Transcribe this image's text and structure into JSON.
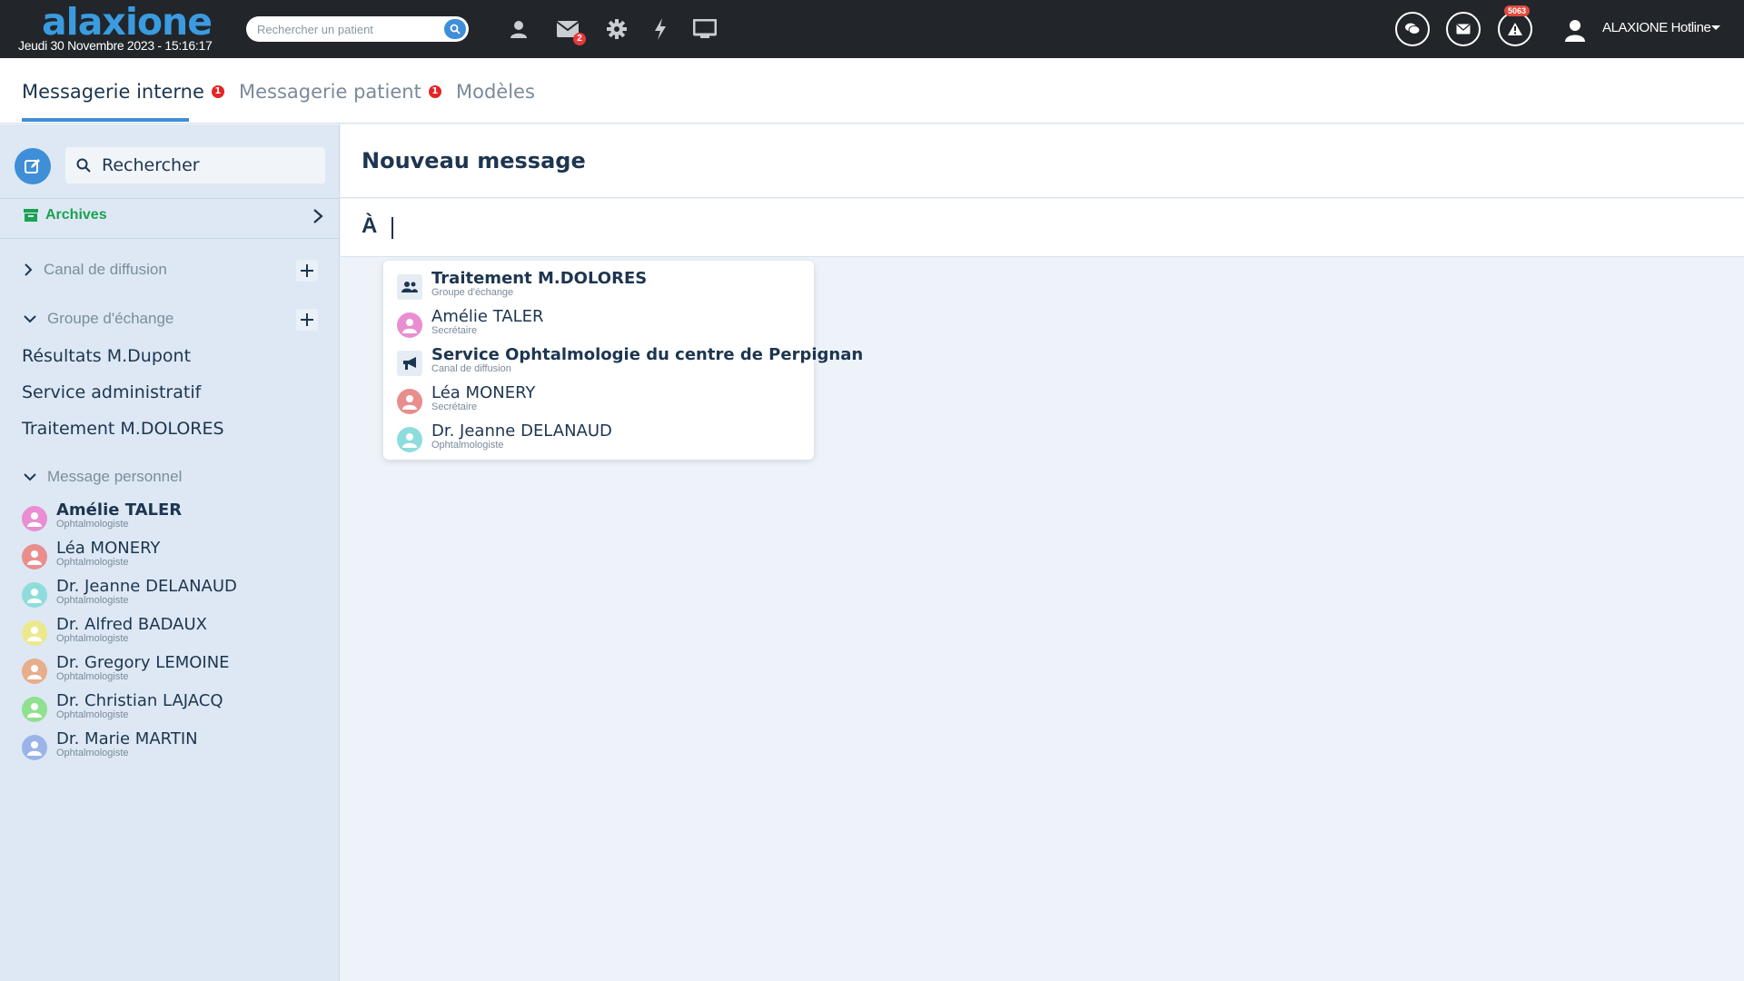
{
  "topbar": {
    "logo": "alaxione",
    "datetime": "Jeudi 30 Novembre 2023 - 15:16:17",
    "search_placeholder": "Rechercher un patient",
    "mail_badge": "2",
    "alert_badge": "5063",
    "user_name": "ALAXIONE Hotline"
  },
  "tabs": [
    {
      "label": "Messagerie interne",
      "badge": "1"
    },
    {
      "label": "Messagerie patient",
      "badge": "1"
    },
    {
      "label": "Modèles"
    }
  ],
  "sidebar": {
    "search_placeholder": "Rechercher",
    "archives_label": "Archives",
    "sections": {
      "broadcast": "Canal de diffusion",
      "exchange_group": "Groupe d'échange",
      "personal": "Message personnel"
    },
    "groups": [
      "Résultats M.Dupont",
      "Service administratif",
      "Traitement M.DOLORES"
    ],
    "contacts": [
      {
        "name": "Amélie TALER",
        "role": "Ophtalmologiste",
        "color": "#e98ed2",
        "bold": true
      },
      {
        "name": "Léa MONERY",
        "role": "Ophtalmologiste",
        "color": "#e98d8d"
      },
      {
        "name": "Dr. Jeanne DELANAUD",
        "role": "Ophtalmologiste",
        "color": "#8fdcdc"
      },
      {
        "name": "Dr. Alfred BADAUX",
        "role": "Ophtalmologiste",
        "color": "#ece98d"
      },
      {
        "name": "Dr. Gregory LEMOINE",
        "role": "Ophtalmologiste",
        "color": "#e8ad8a"
      },
      {
        "name": "Dr. Christian LAJACQ",
        "role": "Ophtalmologiste",
        "color": "#8fe08f"
      },
      {
        "name": "Dr. Marie MARTIN",
        "role": "Ophtalmologiste",
        "color": "#9ab4ea"
      }
    ]
  },
  "main": {
    "title": "Nouveau message",
    "to_label": "À",
    "suggestions": [
      {
        "name": "Traitement M.DOLORES",
        "sub": "Groupe d'échange",
        "icon": "group-icon",
        "bold": true
      },
      {
        "name": "Amélie TALER",
        "sub": "Secrétaire",
        "icon": "user-avatar-icon",
        "color": "#e98ed2"
      },
      {
        "name": "Service Ophtalmologie du centre de Perpignan",
        "sub": "Canal de diffusion",
        "icon": "megaphone-icon",
        "bold": true
      },
      {
        "name": "Léa MONERY",
        "sub": "Secrétaire",
        "icon": "user-avatar-icon",
        "color": "#e98d8d"
      },
      {
        "name": "Dr. Jeanne DELANAUD",
        "sub": "Ophtalmologiste",
        "icon": "user-avatar-icon",
        "color": "#8fdcdc"
      }
    ]
  }
}
